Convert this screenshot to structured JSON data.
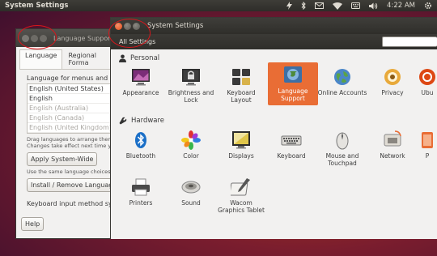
{
  "top_panel": {
    "app_title": "System Settings",
    "clock": "4:22 AM"
  },
  "language_window": {
    "title": "Language Support",
    "tabs": [
      "Language",
      "Regional Forma"
    ],
    "prompt": "Language for menus and wind",
    "languages": [
      {
        "name": "English (United States)",
        "dim": false
      },
      {
        "name": "English",
        "dim": false
      },
      {
        "name": "English (Australia)",
        "dim": true
      },
      {
        "name": "English (Canada)",
        "dim": true
      },
      {
        "name": "English (United Kingdom)",
        "dim": true
      }
    ],
    "hint_line1": "Drag languages to arrange them in",
    "hint_line2": "Changes take effect next time you",
    "apply_button": "Apply System-Wide",
    "hint_line3": "Use the same language choices fo",
    "install_button": "Install / Remove Languages...",
    "keyboard_label": "Keyboard input method syste",
    "help_button": "Help"
  },
  "settings_window": {
    "title": "System Settings",
    "toolbar_label": "All Settings",
    "search_placeholder": "",
    "accent": "#e96d35",
    "sections": {
      "personal": {
        "title": "Personal",
        "items": [
          {
            "label": "Appearance",
            "icon": "appearance-icon"
          },
          {
            "label": "Brightness and Lock",
            "icon": "brightness-lock-icon"
          },
          {
            "label": "Keyboard Layout",
            "icon": "keyboard-layout-icon"
          },
          {
            "label": "Language Support",
            "icon": "language-support-icon",
            "selected": true
          },
          {
            "label": "Online Accounts",
            "icon": "online-accounts-icon"
          },
          {
            "label": "Privacy",
            "icon": "privacy-icon"
          },
          {
            "label": "Ubu",
            "icon": "ubuntu-one-icon"
          }
        ]
      },
      "hardware": {
        "title": "Hardware",
        "items": [
          {
            "label": "Bluetooth",
            "icon": "bluetooth-icon"
          },
          {
            "label": "Color",
            "icon": "color-icon"
          },
          {
            "label": "Displays",
            "icon": "displays-icon"
          },
          {
            "label": "Keyboard",
            "icon": "keyboard-icon"
          },
          {
            "label": "Mouse and Touchpad",
            "icon": "mouse-touchpad-icon"
          },
          {
            "label": "Network",
            "icon": "network-icon"
          },
          {
            "label": "P",
            "icon": "power-icon"
          },
          {
            "label": "Printers",
            "icon": "printers-icon"
          },
          {
            "label": "Sound",
            "icon": "sound-icon"
          },
          {
            "label": "Wacom Graphics Tablet",
            "icon": "wacom-tablet-icon"
          }
        ]
      }
    }
  }
}
